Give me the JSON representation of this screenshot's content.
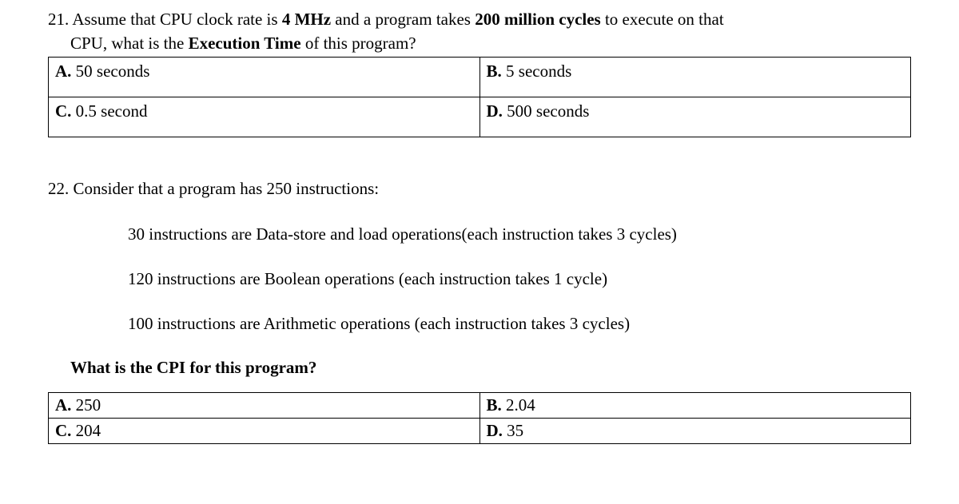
{
  "q21": {
    "number": "21.",
    "text_before_bold1": " Assume that CPU clock rate is ",
    "bold1": "4 MHz",
    "text_mid": " and a program takes ",
    "bold2": "200 million cycles",
    "text_after_bold2": " to execute on that",
    "line2_before": "CPU, what is the ",
    "line2_bold": "Execution Time",
    "line2_after": " of this program?",
    "choices": {
      "a_label": "A.",
      "a_text": " 50 seconds",
      "b_label": "B.",
      "b_text": " 5 seconds",
      "c_label": "C.",
      "c_text": " 0.5 second",
      "d_label": "D.",
      "d_text": " 500 seconds"
    }
  },
  "q22": {
    "number": "22.",
    "text": " Consider that a program has 250 instructions:",
    "sub1": "30 instructions are Data-store and load operations(each instruction takes 3 cycles)",
    "sub2": "120 instructions are Boolean operations (each instruction takes 1 cycle)",
    "sub3": "100 instructions are Arithmetic operations (each instruction  takes 3 cycles)",
    "prompt": "What is the CPI for this program?",
    "choices": {
      "a_label": "A.",
      "a_text": " 250",
      "b_label": "B.",
      "b_text": " 2.04",
      "c_label": "C.",
      "c_text": " 204",
      "d_label": "D.",
      "d_text": " 35"
    }
  }
}
